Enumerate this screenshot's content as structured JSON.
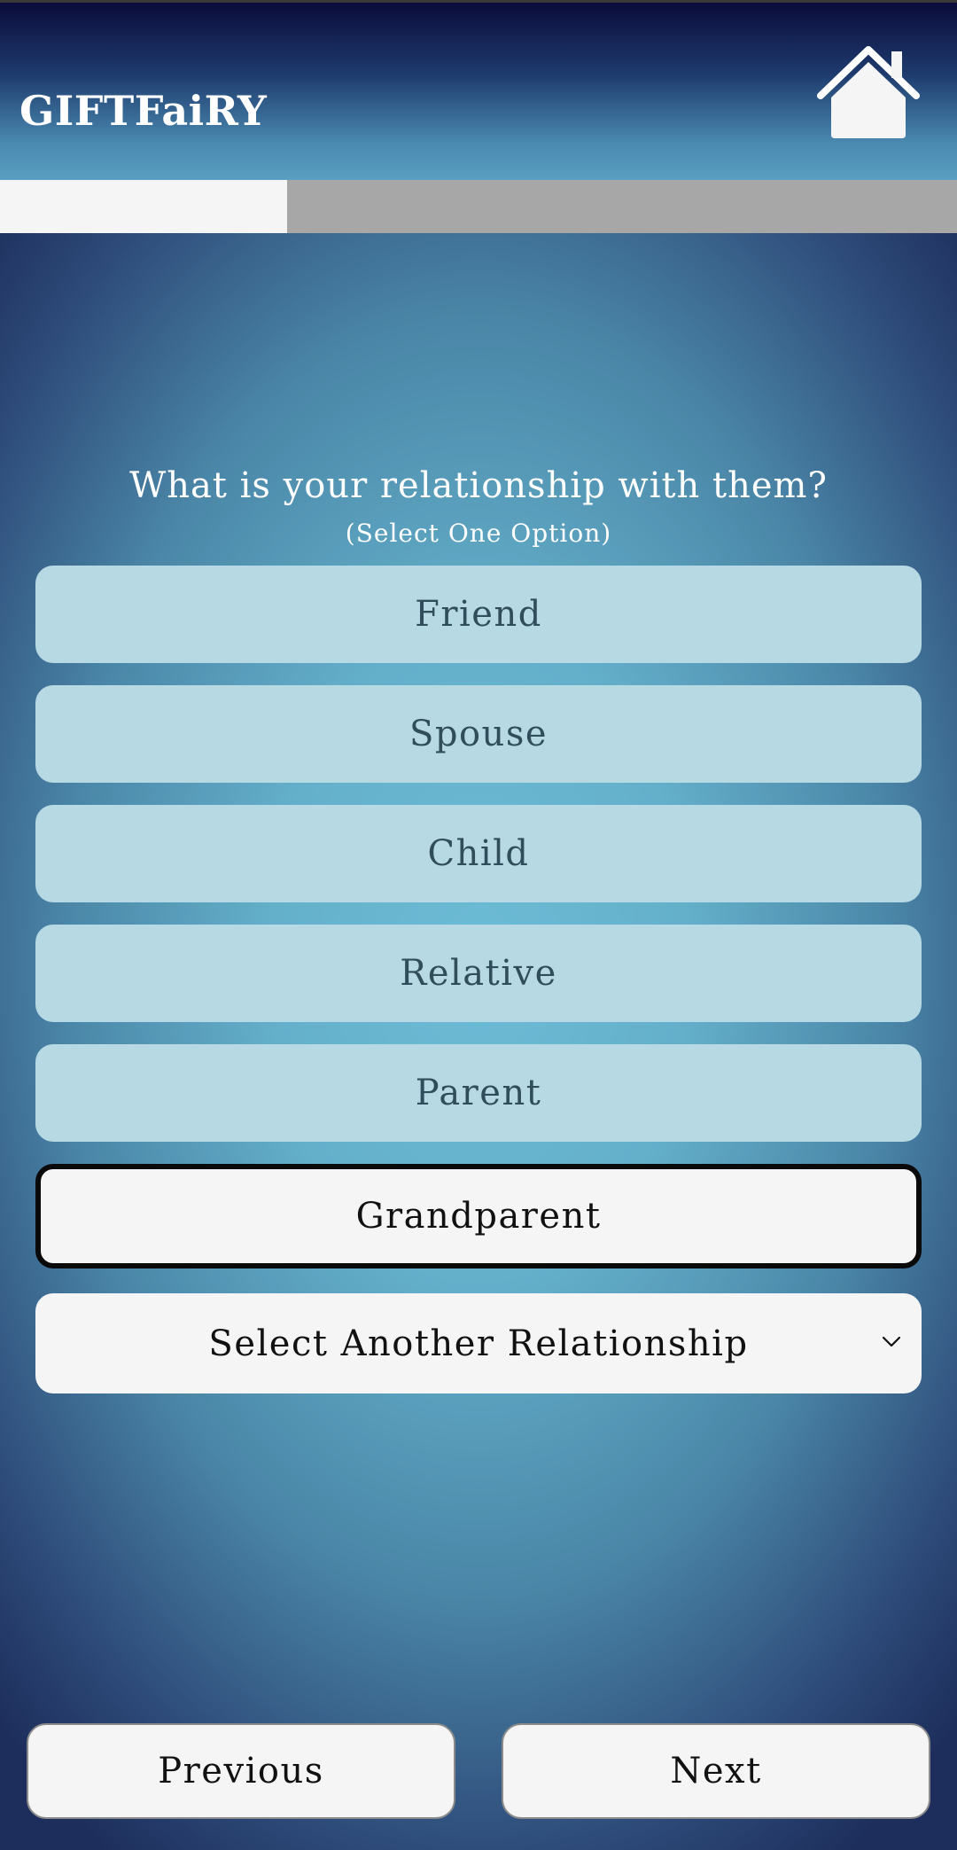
{
  "header": {
    "app_title": "GIFTFaiRY",
    "home_icon": "home-icon"
  },
  "progress": {
    "value": 0.3
  },
  "question": {
    "title": "What is your relationship with them?",
    "subtitle": "(Select One Option)"
  },
  "options": [
    {
      "label": "Friend",
      "selected": false
    },
    {
      "label": "Spouse",
      "selected": false
    },
    {
      "label": "Child",
      "selected": false
    },
    {
      "label": "Relative",
      "selected": false
    },
    {
      "label": "Parent",
      "selected": false
    },
    {
      "label": "Grandparent",
      "selected": true
    }
  ],
  "dropdown": {
    "label": "Select Another Relationship",
    "icon": "chevron-down-icon"
  },
  "nav": {
    "previous_label": "Previous",
    "next_label": "Next"
  }
}
